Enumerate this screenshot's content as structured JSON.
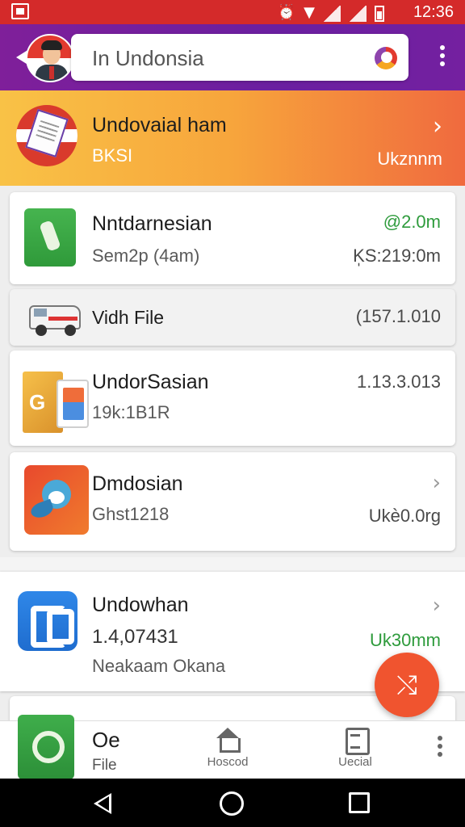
{
  "status_bar": {
    "time": "12:36",
    "icons": [
      "notification-icon",
      "alarm-icon",
      "wifi-icon",
      "signal-icon",
      "battery-icon"
    ],
    "color": "#d42a2a"
  },
  "header": {
    "search_text": "In Undonsia",
    "color": "#6a1fa0"
  },
  "featured": {
    "title": "Undovaial ham",
    "subtitle": "BKSI",
    "meta": "Ukznnm",
    "chevron": "›"
  },
  "items": [
    {
      "title": "Nntdarnesian",
      "subtitle": "Sem2p (4am)",
      "meta_top": "@2.0m",
      "meta_bottom": "K̩S:219:0m"
    },
    {
      "title": "Vidh File",
      "meta": "(157.1.010"
    },
    {
      "title": "UndorSasian",
      "subtitle": "19k:1B1R",
      "meta": "1.13.3.013"
    },
    {
      "title": "Dmdosian",
      "subtitle": "Ghst1218",
      "meta": "Ukè0.0rg",
      "chevron": "›"
    },
    {
      "title": "Undowhan",
      "subtitle": "1.4,07431",
      "subtitle2": "Neakaam Okana",
      "meta": "Uk30mm",
      "chevron": "›"
    }
  ],
  "bottom_nav": {
    "app_title": "Oe",
    "app_sub": "File",
    "tabs": [
      {
        "label": "Hoscod",
        "icon": "home-icon"
      },
      {
        "label": "Uecial",
        "icon": "document-icon"
      }
    ]
  },
  "fab": {
    "glyph": "⤭",
    "color": "#f0542f"
  },
  "accent_colors": {
    "green": "#2e9b3c",
    "banner_start": "#f9c246",
    "banner_end": "#f06a3e"
  }
}
